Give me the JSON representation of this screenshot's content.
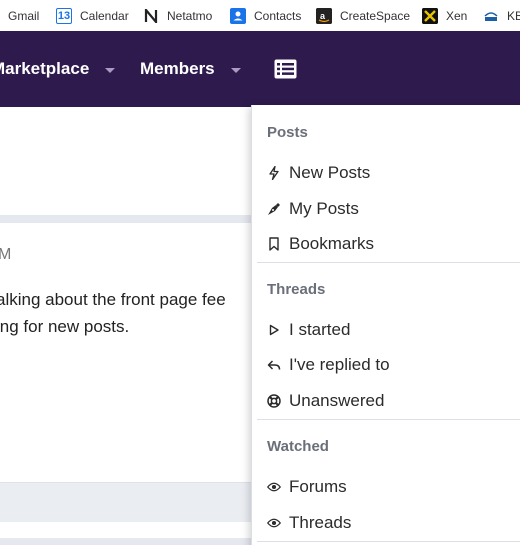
{
  "bookmarks": {
    "gmail": "Gmail",
    "calendar": "Calendar",
    "calendar_icon_text": "13",
    "netatmo": "Netatmo",
    "contacts": "Contacts",
    "createspace": "CreateSpace",
    "xen": "Xen",
    "kbc": "KB"
  },
  "nav": {
    "marketplace": "Marketplace",
    "members": "Members",
    "background": "#2e1a4c"
  },
  "content": {
    "timestamp": "M",
    "line1": "alking about the front page fee",
    "line2": "ing for new posts."
  },
  "menu": {
    "posts_header": "Posts",
    "new_posts": "New Posts",
    "my_posts": "My Posts",
    "bookmarks": "Bookmarks",
    "threads_header": "Threads",
    "i_started": "I started",
    "ive_replied": "I've replied to",
    "unanswered": "Unanswered",
    "watched_header": "Watched",
    "forums": "Forums",
    "threads": "Threads"
  }
}
